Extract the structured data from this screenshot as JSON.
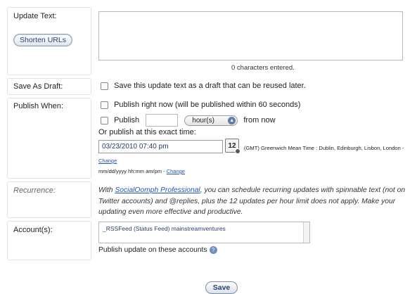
{
  "update_text": {
    "label": "Update Text:",
    "shorten_label": "Shorten URLs",
    "char_count": "0 characters entered."
  },
  "draft": {
    "label": "Save As Draft:",
    "checkbox_label": "Save this update text as a draft that can be reused later."
  },
  "publish": {
    "label": "Publish When:",
    "now_label": "Publish right now (will be published within 60 seconds)",
    "in_prefix": "Publish",
    "in_value": "",
    "unit_value": "hour(s)",
    "in_suffix": "from now",
    "exact_label": "Or publish at this exact time:",
    "datetime_value": "03/23/2010 07:40 pm",
    "cal_day": "12",
    "timezone": "(GMT) Greenwich Mean Time : Dublin, Edinburgh, Lisbon, London -",
    "change_tz": "Change",
    "format_hint": "mm/dd/yyyy hh:mm am/pm -",
    "change_format": "Change"
  },
  "recurrence": {
    "label": "Recurrence:",
    "text_pre": "With ",
    "link": "SocialOomph Professional",
    "text_post": ", you can schedule recurring updates with spinnable text (not on Twitter accounts) and @replies, plus the 12 updates per hour limit does not apply. Make your updating even more effective and productive."
  },
  "accounts": {
    "label": "Account(s):",
    "item": "_RSSFeed (Status Feed) mainstreamventures",
    "hint": "Publish update on these accounts"
  },
  "save_label": "Save"
}
